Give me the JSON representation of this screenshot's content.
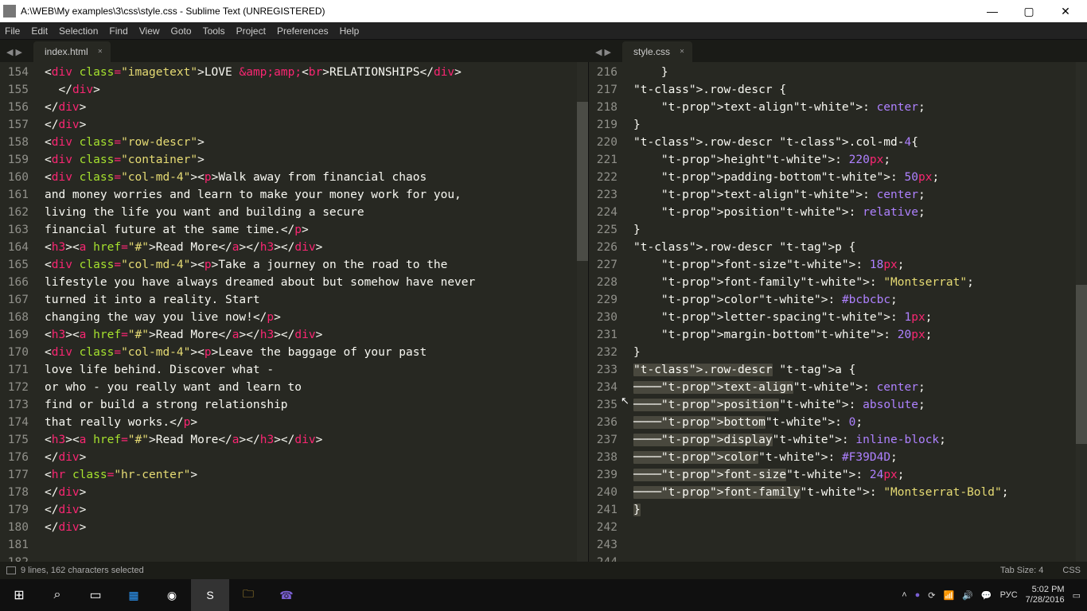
{
  "window": {
    "title": "A:\\WEB\\My examples\\3\\css\\style.css - Sublime Text (UNREGISTERED)"
  },
  "menu": [
    "File",
    "Edit",
    "Selection",
    "Find",
    "View",
    "Goto",
    "Tools",
    "Project",
    "Preferences",
    "Help"
  ],
  "pane_left": {
    "tab": "index.html",
    "first_line": 154,
    "lines": [
      "<div class=\"imagetext\">LOVE &amp;<br>RELATIONSHIPS</div>",
      "  </div>",
      "</div>",
      "</div>",
      "<div class=\"row-descr\">",
      "<div class=\"container\">",
      "<div class=\"col-md-4\"><p>Walk away from financial chaos",
      "and money worries and learn to make your money work for you,",
      "living the life you want and building a secure",
      "financial future at the same time.</p>",
      "<h3><a href=\"#\">Read More</a></h3></div>",
      "<div class=\"col-md-4\"><p>Take a journey on the road to the",
      "lifestyle you have always dreamed about but somehow have never",
      "turned it into a reality. Start",
      "changing the way you live now!</p>",
      "<h3><a href=\"#\">Read More</a></h3></div>",
      "<div class=\"col-md-4\"><p>Leave the baggage of your past",
      "love life behind. Discover what -",
      "or who - you really want and learn to",
      "find or build a strong relationship",
      "that really works.</p>",
      "<h3><a href=\"#\">Read More</a></h3></div>",
      "",
      "</div>",
      "<hr class=\"hr-center\">",
      "</div>",
      "</div>",
      "</div>",
      ""
    ]
  },
  "pane_right": {
    "tab": "style.css",
    "first_line": 216,
    "selected_start": 235,
    "selected_end": 243,
    "lines": [
      "    }",
      "",
      ".row-descr {",
      "    text-align: center;",
      "}",
      ".row-descr .col-md-4{",
      "",
      "    height: 220px;",
      "    padding-bottom: 50px;",
      "    text-align: center;",
      "    position: relative;",
      "}",
      ".row-descr p {",
      "    font-size: 18px;",
      "    font-family: \"Montserrat\";",
      "    color: #bcbcbc;",
      "    letter-spacing: 1px;",
      "    margin-bottom: 20px;",
      "}",
      ".row-descr a {",
      "    text-align: center;",
      "    position: absolute;",
      "    bottom: 0;",
      "    display: inline-block;",
      "    color: #F39D4D;",
      "    font-size: 24px;",
      "    font-family: \"Montserrat-Bold\";",
      "}",
      ""
    ]
  },
  "status": {
    "left": "9 lines, 162 characters selected",
    "tab_size": "Tab Size: 4",
    "syntax": "CSS"
  },
  "tray": {
    "lang": "РУС",
    "time": "5:02 PM",
    "date": "7/28/2016"
  }
}
